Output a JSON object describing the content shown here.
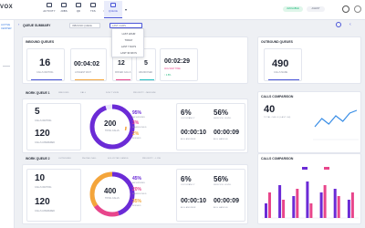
{
  "app": {
    "brand": "VOX"
  },
  "nav": {
    "items": [
      {
        "label": "ACTIVITY"
      },
      {
        "label": "JOBS"
      },
      {
        "label": "QD"
      },
      {
        "label": "TKS"
      },
      {
        "label": "EMAIL"
      },
      {
        "label": "QUEUE"
      }
    ],
    "status": "AVAILABLE",
    "agent": "AGENT"
  },
  "sidebar": {
    "tag": "ACTIVE CENTER"
  },
  "header": {
    "title": "QUEUE SUMMARY",
    "select1": "INBOUND QUEUE",
    "select2": "LAST 4 HRS"
  },
  "dropdown": {
    "options": [
      "LAST HOUR",
      "TODAY",
      "LAST 7 DAYS",
      "LAST 30 DAYS"
    ]
  },
  "inbound": {
    "title": "INBOUND QUEUES",
    "calls": "16",
    "calls_label": "CALLS WAITING",
    "wait": "00:04:02",
    "wait_label": "LONGEST WAIT",
    "missed": "12",
    "missed_label": "MISSED CALLS",
    "abandon": "5",
    "abandon_label": "ABANDONED",
    "rate": "00:02:29",
    "rate_label": "AVG WAIT TIME",
    "rate_note": "↑ 4.5%"
  },
  "outbound": {
    "title": "OUTBOUND QUEUES",
    "calls": "490",
    "calls_label": "CALLS MADE"
  },
  "queue1": {
    "title": "WORK QUEUE 1",
    "filters": [
      "INBOUND",
      "CALL",
      "DOUT VIEW",
      "PRIORITY - MEDIUM"
    ],
    "calls": "5",
    "calls_label": "CALLS WAITING",
    "done": "120",
    "done_label": "CALLS ANSWERED",
    "donut_value": "200",
    "donut_label": "TOTAL CALLS",
    "p1": "95%",
    "p1_label": "ANSWERED",
    "p2": "3%",
    "p2_label": "ABANDONED",
    "p3": "2%",
    "p3_label": "MISSED",
    "m1": "6%",
    "m1_label": "OCCUPANCY",
    "m2": "56%",
    "m2_label": "SERVICE LEVEL",
    "m3": "00:00:10",
    "m3_label": "AVG ANSWER",
    "m4": "00:00:09",
    "m4_label": "AVG HANDLE"
  },
  "queue2": {
    "title": "WORK QUEUE 2",
    "filters": [
      "OUTBOUND",
      "PHONE CALL",
      "SOLICITED SENDS",
      "PRIORITY - LOW"
    ],
    "calls": "10",
    "calls_label": "CALLS WAITING",
    "done": "120",
    "done_label": "CALLS ANSWERED",
    "donut_value": "400",
    "donut_label": "TOTAL CALLS",
    "p1": "45%",
    "p1_label": "ANSWERED",
    "p2": "20%",
    "p2_label": "ABANDONED",
    "p3": "35%",
    "p3_label": "MISSED",
    "m1": "6%",
    "m1_label": "OCCUPANCY",
    "m2": "56%",
    "m2_label": "SERVICE LEVEL",
    "m3": "00:00:10",
    "m3_label": "AVG ANSWER",
    "m4": "00:00:09",
    "m4_label": "AVG HANDLE"
  },
  "comparison1": {
    "title": "CALLS COMPARISON",
    "value": "40",
    "value_label": "TOTAL CALLS (LAST 4H)",
    "series_values": [
      4,
      7,
      5,
      8,
      6,
      9,
      10
    ]
  },
  "comparison2": {
    "title": "CALLS COMPARISON",
    "series": [
      {
        "values": [
          4,
          9,
          6,
          10,
          7,
          8,
          5
        ]
      },
      {
        "values": [
          7,
          5,
          8,
          4,
          9,
          6,
          7
        ]
      }
    ]
  },
  "colors": {
    "accent": "#4a55d8",
    "purple": "#6b2bd6",
    "pink": "#e8458b",
    "orange": "#f4a53b",
    "green": "#1bb67a",
    "blue": "#3a8ee6",
    "teal": "#22c1c3"
  }
}
